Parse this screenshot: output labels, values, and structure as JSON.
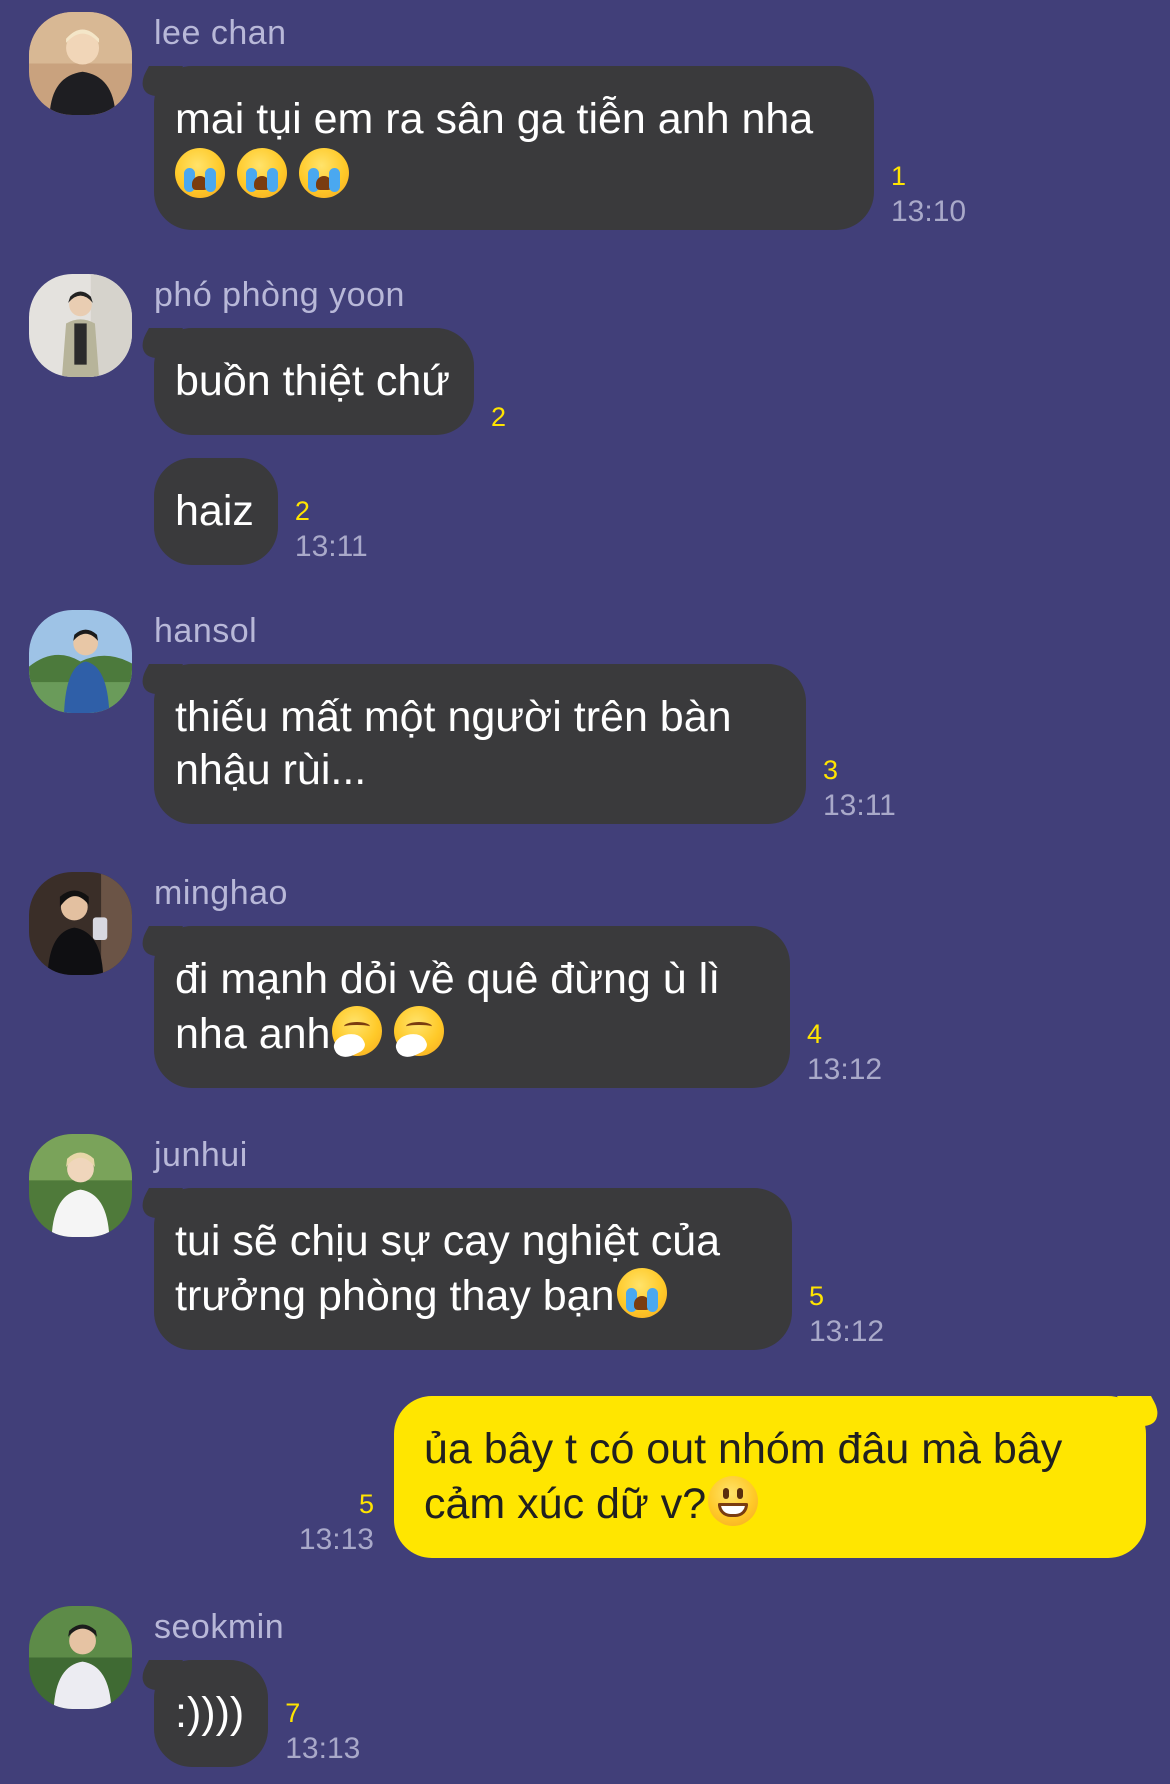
{
  "colors": {
    "background": "#413f79",
    "incoming_bubble": "#3a3a3c",
    "outgoing_bubble": "#ffe600",
    "unread_count": "#ffe400",
    "sender_name": "#b8b8d8"
  },
  "messages": [
    {
      "sender": "lee chan",
      "bubbles": [
        {
          "lines": [
            "mai tụi em ra sân ga tiễn anh nha"
          ],
          "emojis": [
            "crying-face",
            "crying-face",
            "crying-face"
          ],
          "count": "1",
          "time": "13:10"
        }
      ]
    },
    {
      "sender": "phó phòng yoon",
      "bubbles": [
        {
          "lines": [
            "buồn thiệt chứ"
          ],
          "count": "2",
          "time": ""
        },
        {
          "lines": [
            "haiz"
          ],
          "count": "2",
          "time": "13:11"
        }
      ]
    },
    {
      "sender": "hansol",
      "bubbles": [
        {
          "lines": [
            "thiếu mất một người trên bàn",
            "nhậu rùi..."
          ],
          "count": "3",
          "time": "13:11"
        }
      ]
    },
    {
      "sender": "minghao",
      "bubbles": [
        {
          "lines": [
            "đi mạnh dỏi về quê đừng ù lì",
            "nha anh"
          ],
          "emojis": [
            "sneezing-face",
            "sneezing-face"
          ],
          "count": "4",
          "time": "13:12"
        }
      ]
    },
    {
      "sender": "junhui",
      "bubbles": [
        {
          "lines": [
            "tui sẽ chịu sự cay nghiệt của",
            "trưởng phòng thay bạn"
          ],
          "emojis": [
            "crying-face"
          ],
          "count": "5",
          "time": "13:12"
        }
      ]
    },
    {
      "sender": "me",
      "outgoing": true,
      "bubbles": [
        {
          "lines": [
            "ủa bây t có out nhóm đâu mà bây",
            "cảm xúc dữ v?"
          ],
          "emojis": [
            "grinning-face"
          ],
          "count": "5",
          "time": "13:13"
        }
      ]
    },
    {
      "sender": "seokmin",
      "bubbles": [
        {
          "lines": [
            ":))))"
          ],
          "count": "7",
          "time": "13:13"
        }
      ]
    }
  ]
}
